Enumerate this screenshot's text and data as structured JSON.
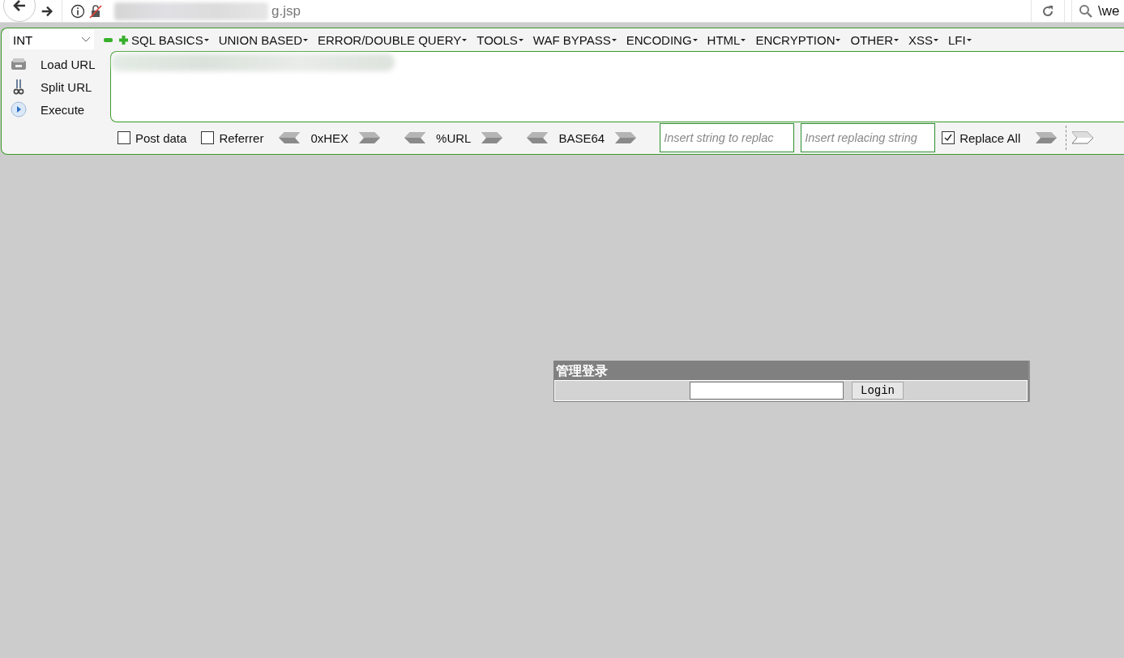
{
  "browser": {
    "url": "g.jsp",
    "search": "\\we"
  },
  "hackbar": {
    "level_select": "INT",
    "menus": [
      "SQL BASICS",
      "UNION BASED",
      "ERROR/DOUBLE QUERY",
      "TOOLS",
      "WAF BYPASS",
      "ENCODING",
      "HTML",
      "ENCRYPTION",
      "OTHER",
      "XSS",
      "LFI"
    ],
    "actions": [
      {
        "kind": "load",
        "label": "Load URL"
      },
      {
        "kind": "split",
        "label": "Split URL"
      },
      {
        "kind": "execute",
        "label": "Execute"
      }
    ],
    "options": [
      {
        "label": "Post data",
        "checked": false
      },
      {
        "label": "Referrer",
        "checked": false
      }
    ],
    "encoders": [
      "0xHEX",
      "%URL",
      "BASE64"
    ],
    "replace_from": {
      "placeholder": "Insert string to replac"
    },
    "replace_to": {
      "placeholder": "Insert replacing string"
    },
    "replace_all": {
      "label": "Replace All",
      "checked": true
    }
  },
  "login": {
    "title": "管理登录",
    "button": "Login"
  }
}
